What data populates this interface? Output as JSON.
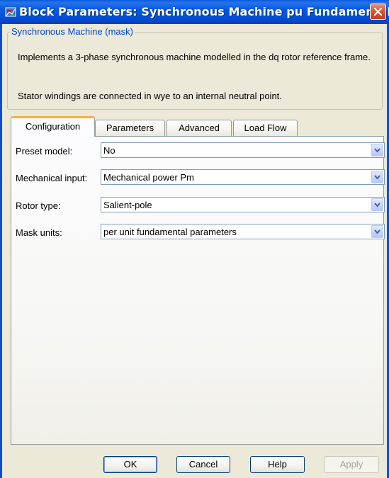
{
  "window": {
    "title": "Block Parameters: Synchronous Machine pu Fundamental"
  },
  "group": {
    "legend": "Synchronous Machine (mask)",
    "description_1": "Implements a 3-phase synchronous machine modelled in the dq rotor reference frame.",
    "description_2": "Stator windings are connected in wye to an internal neutral point."
  },
  "tabs": [
    {
      "label": "Configuration",
      "active": true
    },
    {
      "label": "Parameters",
      "active": false
    },
    {
      "label": "Advanced",
      "active": false
    },
    {
      "label": "Load Flow",
      "active": false
    }
  ],
  "fields": [
    {
      "label": "Preset model:",
      "value": "No"
    },
    {
      "label": "Mechanical input:",
      "value": "Mechanical power Pm"
    },
    {
      "label": "Rotor type:",
      "value": "Salient-pole"
    },
    {
      "label": "Mask units:",
      "value": "per unit fundamental parameters"
    }
  ],
  "buttons": {
    "ok": "OK",
    "cancel": "Cancel",
    "help": "Help",
    "apply": "Apply"
  },
  "colors": {
    "titlebar": "#0058e6",
    "close": "#d8552f",
    "legend": "#0046d5",
    "tab_highlight": "#f5b042"
  }
}
